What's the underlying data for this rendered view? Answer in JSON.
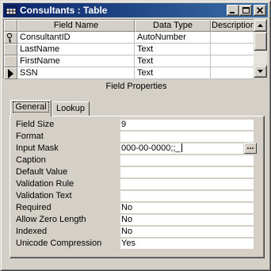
{
  "window": {
    "title": "Consultants : Table",
    "buttons": [
      "minimize-icon",
      "maximize-icon",
      "close-icon"
    ]
  },
  "grid": {
    "columns": [
      "Field Name",
      "Data Type",
      "Description"
    ],
    "rows": [
      {
        "field_name": "ConsultantID",
        "data_type": "AutoNumber",
        "description": "",
        "indicator": "key-icon"
      },
      {
        "field_name": "LastName",
        "data_type": "Text",
        "description": "",
        "indicator": ""
      },
      {
        "field_name": "FirstName",
        "data_type": "Text",
        "description": "",
        "indicator": ""
      },
      {
        "field_name": "SSN",
        "data_type": "Text",
        "description": "",
        "indicator": "row-pointer-icon"
      }
    ]
  },
  "field_properties": {
    "label": "Field Properties",
    "tabs": [
      "General",
      "Lookup"
    ],
    "active_tab": "General",
    "properties": [
      {
        "name": "Field Size",
        "value": "9"
      },
      {
        "name": "Format",
        "value": ""
      },
      {
        "name": "Input Mask",
        "value": "000-00-0000;;_"
      },
      {
        "name": "Caption",
        "value": ""
      },
      {
        "name": "Default Value",
        "value": ""
      },
      {
        "name": "Validation Rule",
        "value": ""
      },
      {
        "name": "Validation Text",
        "value": ""
      },
      {
        "name": "Required",
        "value": "No"
      },
      {
        "name": "Allow Zero Length",
        "value": "No"
      },
      {
        "name": "Indexed",
        "value": "No"
      },
      {
        "name": "Unicode Compression",
        "value": "Yes"
      }
    ],
    "builder_button_label": "..."
  }
}
